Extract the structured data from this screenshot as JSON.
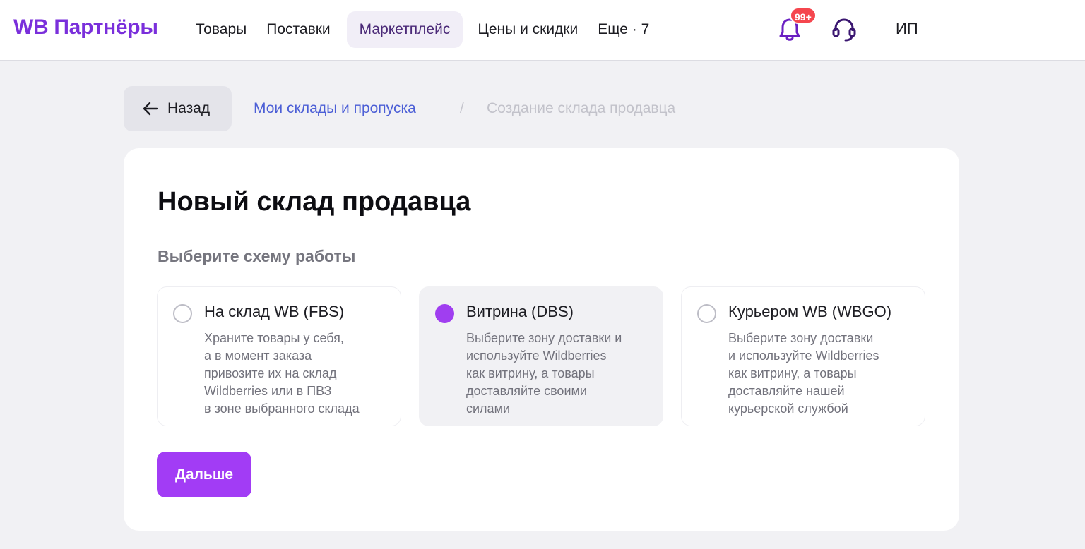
{
  "header": {
    "logo": "WB Партнёры",
    "nav": [
      {
        "label": "Товары",
        "active": false
      },
      {
        "label": "Поставки",
        "active": false
      },
      {
        "label": "Маркетплейс",
        "active": true
      },
      {
        "label": "Цены и скидки",
        "active": false
      },
      {
        "label": "Еще · 7",
        "active": false
      }
    ],
    "notifications_badge": "99+",
    "profile_label": "ИП"
  },
  "breadcrumbs": {
    "back_label": "Назад",
    "parent": "Мои склады и пропуска",
    "separator": "/",
    "current": "Создание склада продавца"
  },
  "card": {
    "title": "Новый склад продавца",
    "subtitle": "Выберите схему работы",
    "options": [
      {
        "title": "На склад WB (FBS)",
        "selected": false,
        "lines": [
          "Храните товары у себя,",
          "а в момент заказа",
          "привозите их на склад",
          "Wildberries или в ПВЗ",
          "в зоне выбранного склада"
        ]
      },
      {
        "title": "Витрина (DBS)",
        "selected": true,
        "lines": [
          "Выберите зону доставки и",
          "используйте Wildberries",
          "как витрину, а товары",
          "доставляйте своими",
          "силами"
        ]
      },
      {
        "title": "Курьером WB (WBGO)",
        "selected": false,
        "lines": [
          "Выберите зону доставки",
          "и используйте Wildberries",
          "как витрину, а товары",
          "доставляйте нашей",
          "курьерской службой"
        ]
      }
    ],
    "next_label": "Дальше"
  },
  "colors": {
    "brand": "#7a2fdb",
    "accent": "#a23cf5",
    "link": "#4c5fd6",
    "badge": "#f5464e"
  },
  "icons": {
    "back": "arrow-left-icon",
    "notifications": "bell-icon",
    "support": "headset-icon"
  }
}
